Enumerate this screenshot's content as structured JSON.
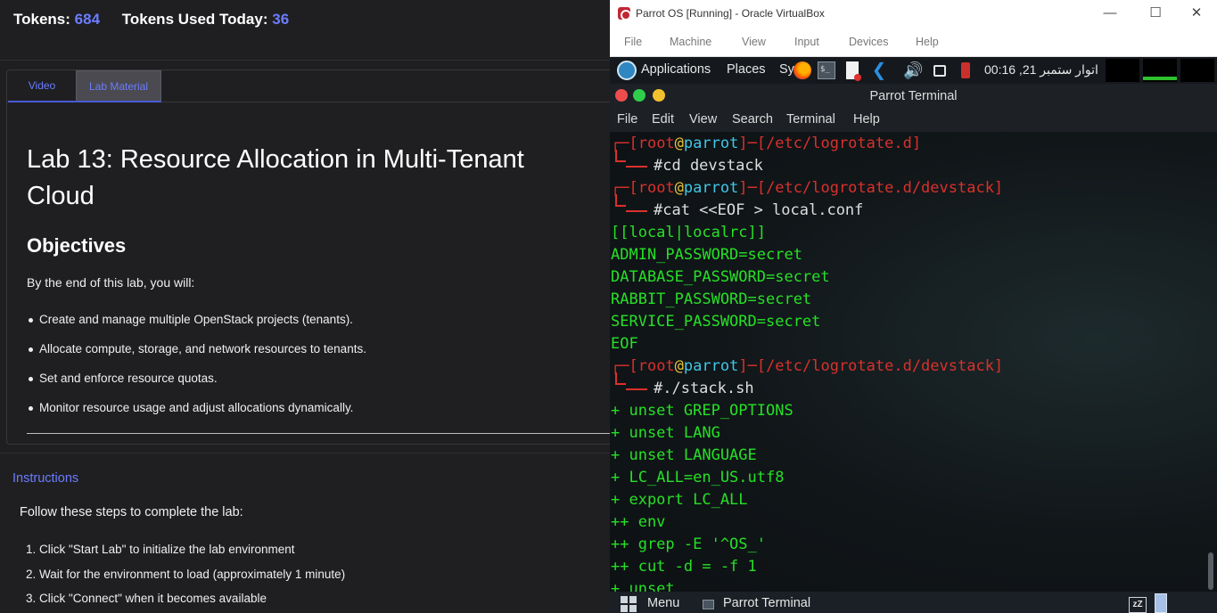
{
  "left": {
    "tokens_label": "Tokens:",
    "tokens_value": "684",
    "tokens_used_label": "Tokens Used Today:",
    "tokens_used_value": "36",
    "tabs": [
      "Video",
      "Lab Material"
    ],
    "lab_title": "Lab 13: Resource Allocation in Multi-Tenant Cloud",
    "objectives_title": "Objectives",
    "objectives_intro": "By the end of this lab, you will:",
    "objectives": [
      "Create and manage multiple OpenStack projects (tenants).",
      "Allocate compute, storage, and network resources to tenants.",
      "Set and enforce resource quotas.",
      "Monitor resource usage and adjust allocations dynamically."
    ],
    "instructions_title": "Instructions",
    "instructions_intro": "Follow these steps to complete the lab:",
    "steps": [
      "1. Click \"Start Lab\" to initialize the lab environment",
      "2. Wait for the environment to load (approximately 1 minute)",
      "3. Click \"Connect\" when it becomes available"
    ]
  },
  "vbox": {
    "title": "Parrot OS [Running] - Oracle VirtualBox",
    "window_controls": [
      "—",
      "☐",
      "✕"
    ],
    "menu": [
      "File",
      "Machine",
      "View",
      "Input",
      "Devices",
      "Help"
    ],
    "panel": {
      "applications": "Applications",
      "places": "Places",
      "system": "Sy",
      "term_icon_text": "$_",
      "clock": "اتوار ستمبر 21, 00:16"
    },
    "terminal": {
      "title": "Parrot Terminal",
      "menu": [
        "File",
        "Edit",
        "View",
        "Search",
        "Terminal",
        "Help"
      ],
      "prompt_user": "root",
      "prompt_at": "@",
      "prompt_host": "parrot",
      "prompts": [
        {
          "path": "[/etc/logrotate.d]",
          "cmd": "#cd devstack"
        },
        {
          "path": "[/etc/logrotate.d/devstack]",
          "cmd": "#cat <<EOF > local.conf"
        },
        {
          "path": "[/etc/logrotate.d/devstack]",
          "cmd": "#./stack.sh"
        }
      ],
      "heredoc": [
        "[[local|localrc]]",
        "ADMIN_PASSWORD=secret",
        "DATABASE_PASSWORD=secret",
        "RABBIT_PASSWORD=secret",
        "SERVICE_PASSWORD=secret",
        "EOF"
      ],
      "output": [
        "+ unset GREP_OPTIONS",
        "+ unset LANG",
        "+ unset LANGUAGE",
        "+ LC_ALL=en_US.utf8",
        "+ export LC_ALL",
        "++ env",
        "++ grep -E '^OS_'",
        "++ cut -d = -f 1",
        "+ unset"
      ]
    },
    "taskbar": {
      "menu": "Menu",
      "window": "Parrot Terminal",
      "sleep_icon_text": "zZ"
    }
  },
  "colors": {
    "accent": "#6b7dff",
    "terminal_green": "#26e026",
    "prompt_red": "#d9312c",
    "host_cyan": "#3fc7e8",
    "at_yellow": "#e8c33a"
  }
}
